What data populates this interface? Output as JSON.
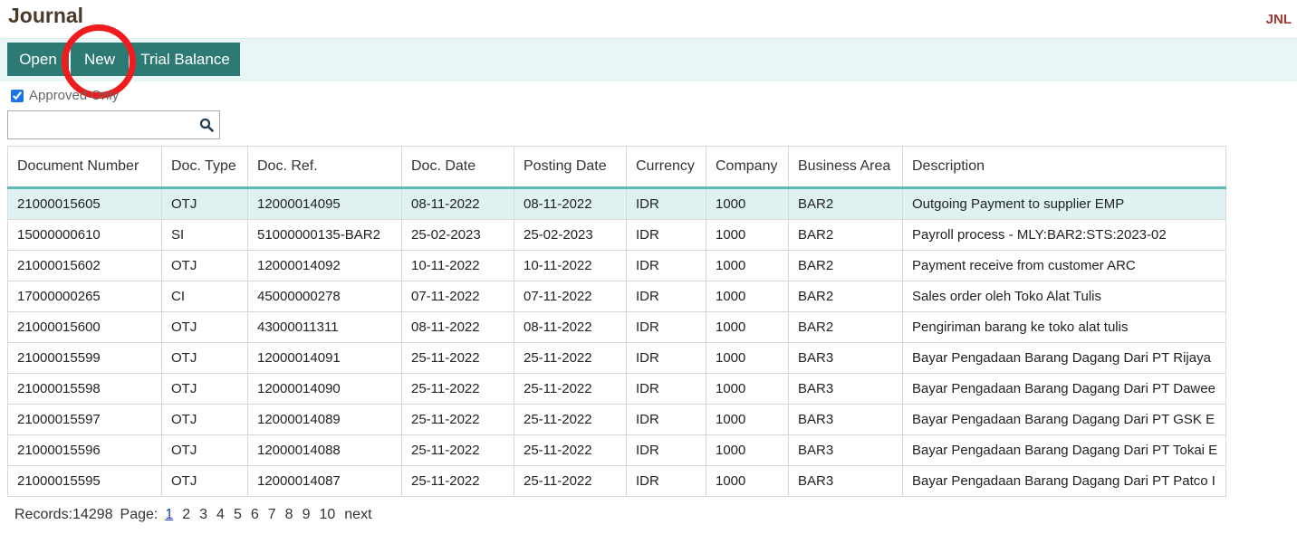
{
  "page": {
    "title": "Journal",
    "code": "JNL"
  },
  "toolbar": {
    "open_label": "Open",
    "new_label": "New",
    "trial_balance_label": "Trial Balance"
  },
  "filter": {
    "approved_only_label": "Approved Only",
    "approved_only_checked": true
  },
  "search": {
    "value": "",
    "placeholder": ""
  },
  "table": {
    "columns": [
      "Document Number",
      "Doc. Type",
      "Doc. Ref.",
      "Doc. Date",
      "Posting Date",
      "Currency",
      "Company",
      "Business Area",
      "Description"
    ],
    "rows": [
      [
        "21000015605",
        "OTJ",
        "12000014095",
        "08-11-2022",
        "08-11-2022",
        "IDR",
        "1000",
        "BAR2",
        "Outgoing Payment to supplier EMP"
      ],
      [
        "15000000610",
        "SI",
        "51000000135-BAR2",
        "25-02-2023",
        "25-02-2023",
        "IDR",
        "1000",
        "BAR2",
        "Payroll process - MLY:BAR2:STS:2023-02"
      ],
      [
        "21000015602",
        "OTJ",
        "12000014092",
        "10-11-2022",
        "10-11-2022",
        "IDR",
        "1000",
        "BAR2",
        "Payment receive from customer ARC"
      ],
      [
        "17000000265",
        "CI",
        "45000000278",
        "07-11-2022",
        "07-11-2022",
        "IDR",
        "1000",
        "BAR2",
        "Sales order oleh Toko Alat Tulis"
      ],
      [
        "21000015600",
        "OTJ",
        "43000011311",
        "08-11-2022",
        "08-11-2022",
        "IDR",
        "1000",
        "BAR2",
        "Pengiriman barang ke toko alat tulis"
      ],
      [
        "21000015599",
        "OTJ",
        "12000014091",
        "25-11-2022",
        "25-11-2022",
        "IDR",
        "1000",
        "BAR3",
        "Bayar Pengadaan Barang Dagang Dari PT Rijaya"
      ],
      [
        "21000015598",
        "OTJ",
        "12000014090",
        "25-11-2022",
        "25-11-2022",
        "IDR",
        "1000",
        "BAR3",
        "Bayar Pengadaan Barang Dagang Dari PT Dawee"
      ],
      [
        "21000015597",
        "OTJ",
        "12000014089",
        "25-11-2022",
        "25-11-2022",
        "IDR",
        "1000",
        "BAR3",
        "Bayar Pengadaan Barang Dagang Dari PT GSK E"
      ],
      [
        "21000015596",
        "OTJ",
        "12000014088",
        "25-11-2022",
        "25-11-2022",
        "IDR",
        "1000",
        "BAR3",
        "Bayar Pengadaan Barang Dagang Dari PT Tokai E"
      ],
      [
        "21000015595",
        "OTJ",
        "12000014087",
        "25-11-2022",
        "25-11-2022",
        "IDR",
        "1000",
        "BAR3",
        "Bayar Pengadaan Barang Dagang Dari PT Patco I"
      ]
    ],
    "selected_row": 0
  },
  "pager": {
    "records_label": "Records:14298",
    "page_label": "Page:",
    "pages": [
      "1",
      "2",
      "3",
      "4",
      "5",
      "6",
      "7",
      "8",
      "9",
      "10"
    ],
    "current_page": "1",
    "next_label": "next"
  },
  "colors": {
    "accent": "#2d7a74",
    "toolbar_bg": "#e8f6f6",
    "selected_row": "#dff2f1",
    "highlight": "#ee1c1c"
  },
  "icons": {
    "search": "search-icon"
  }
}
